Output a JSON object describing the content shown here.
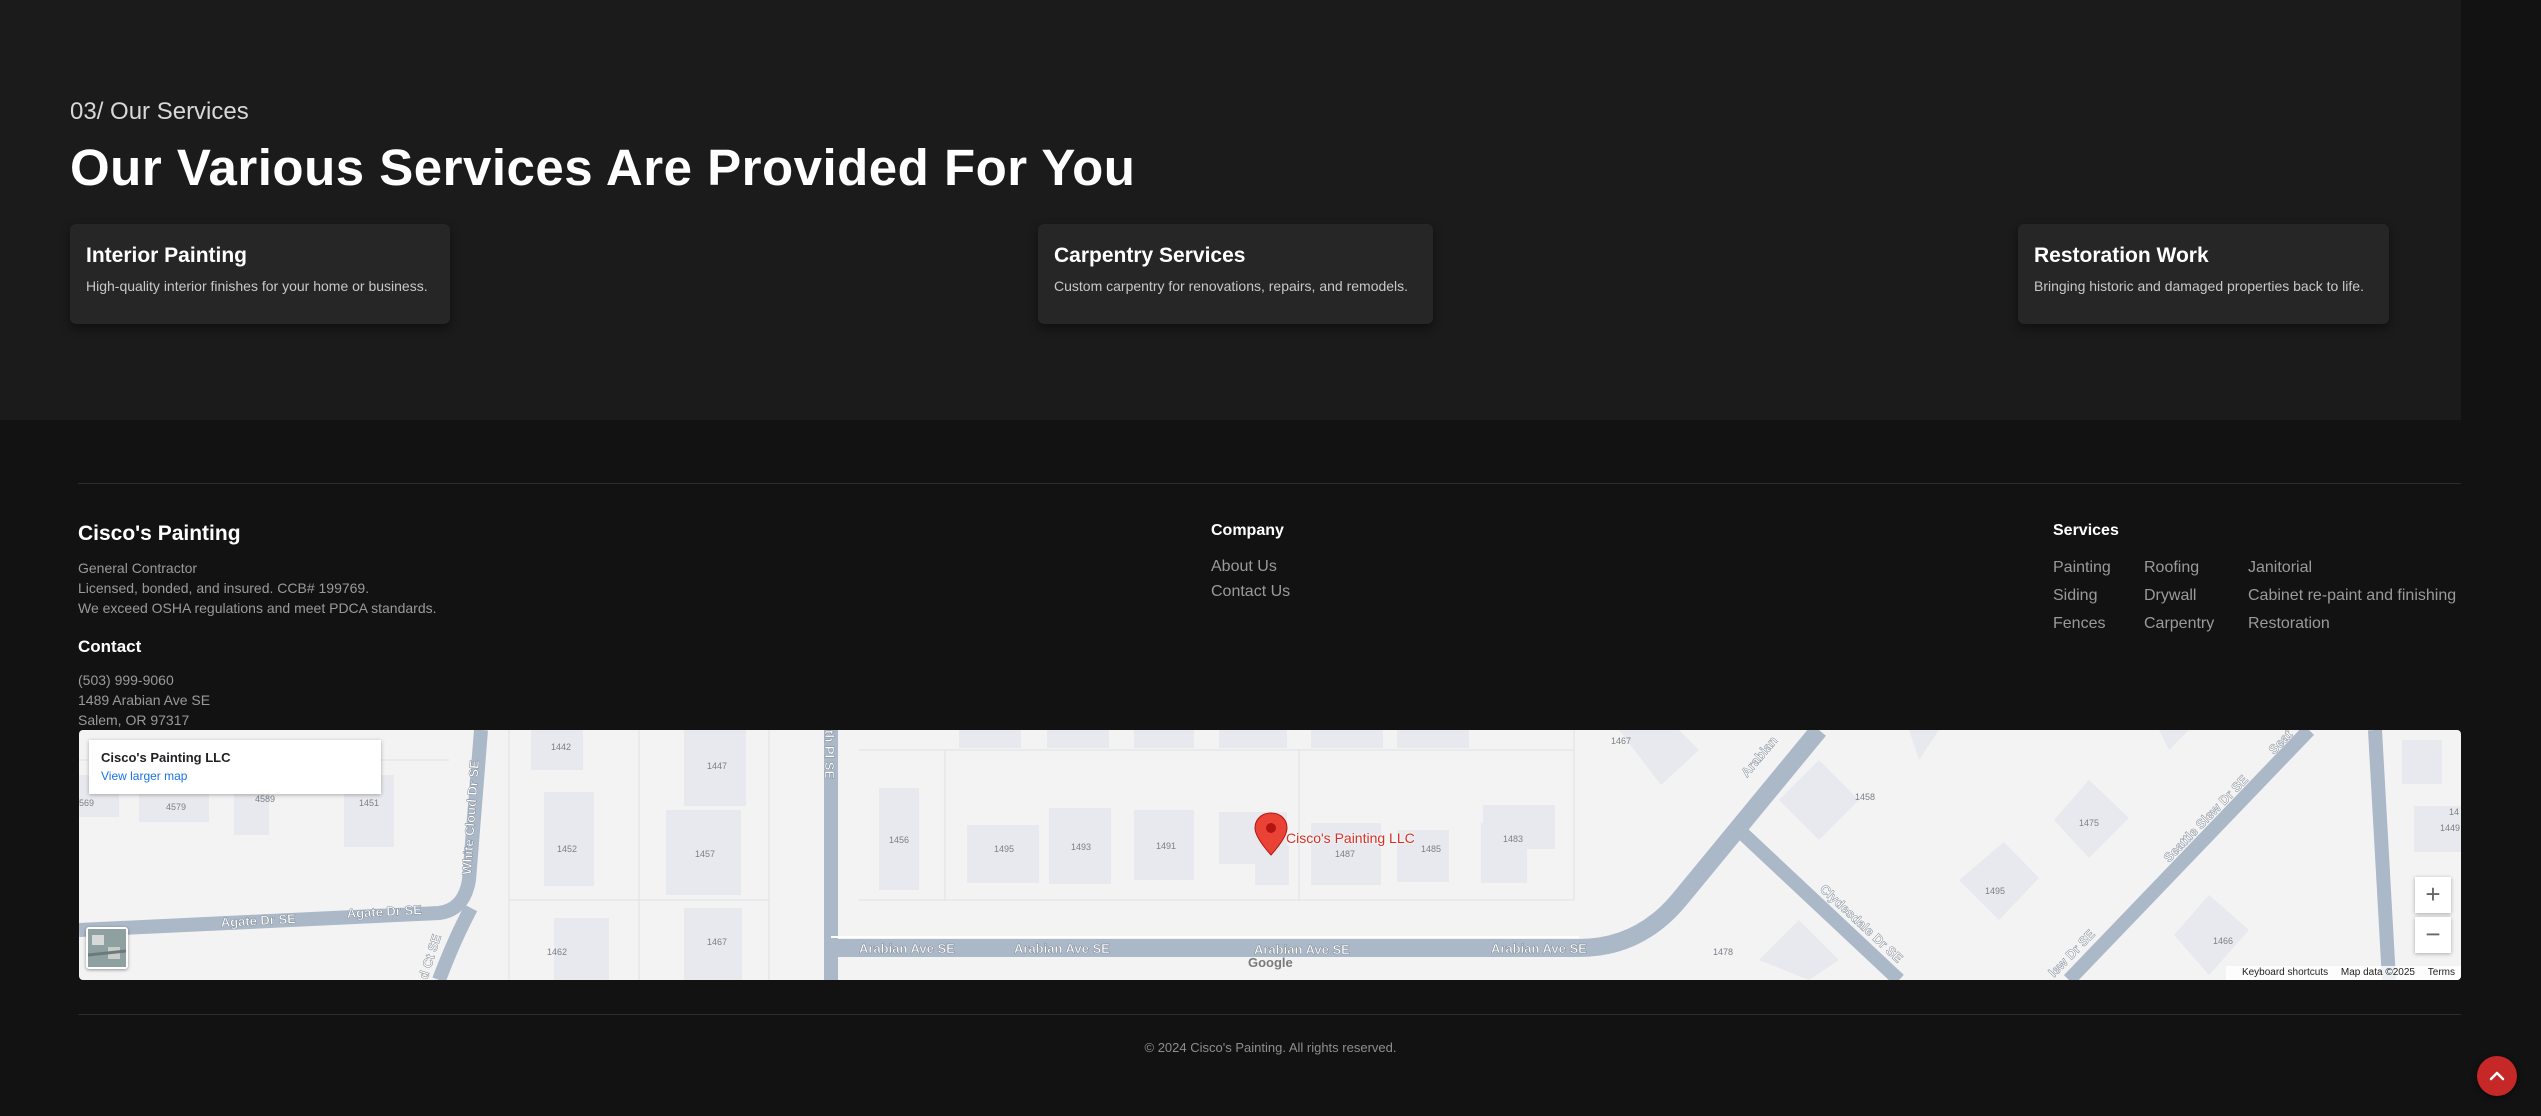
{
  "services": {
    "eyebrow": "03/ Our Services",
    "heading": "Our Various Services Are Provided For You",
    "cards": [
      {
        "title": "Interior Painting",
        "description": "High-quality interior finishes for your home or business."
      },
      {
        "title": "Carpentry Services",
        "description": "Custom carpentry for renovations, repairs, and remodels."
      },
      {
        "title": "Restoration Work",
        "description": "Bringing historic and damaged properties back to life."
      }
    ]
  },
  "footer": {
    "brand": {
      "title": "Cisco's Painting",
      "lines": [
        "General Contractor",
        "Licensed, bonded, and insured. CCB# 199769.",
        "We exceed OSHA regulations and meet PDCA standards."
      ]
    },
    "contact": {
      "title": "Contact",
      "phone": "(503) 999-9060",
      "address_line1": "1489 Arabian Ave SE",
      "address_line2": "Salem, OR 97317"
    },
    "company": {
      "title": "Company",
      "links": [
        "About Us",
        "Contact Us"
      ]
    },
    "service_links": {
      "title": "Services",
      "columns": [
        [
          "Painting",
          "Siding",
          "Fences"
        ],
        [
          "Roofing",
          "Drywall",
          "Carpentry"
        ],
        [
          "Janitorial",
          "Cabinet re-paint and finishing",
          "Restoration"
        ]
      ]
    },
    "copyright": "© 2024 Cisco's Painting. All rights reserved."
  },
  "map": {
    "place_name": "Cisco's Painting LLC",
    "larger_map_link": "View larger map",
    "marker_label": "Cisco's Painting LLC",
    "zoom_in": "+",
    "zoom_out": "−",
    "google_logo": "Google",
    "attribution": {
      "shortcuts": "Keyboard shortcuts",
      "data": "Map data ©2025",
      "terms": "Terms"
    },
    "street_labels": [
      "Arabian Ave SE",
      "Arabian Ave SE",
      "Arabian Ave SE",
      "Arabian Ave SE",
      "Agate Dr SE",
      "Agate Dr SE",
      "White Cloud Dr SE",
      "Clydesdale Dr SE",
      "Seattle Slew Dr SE",
      "Arabian",
      "th Pl SE",
      "d Ct SE",
      "Seat",
      "lew Dr SE"
    ],
    "house_numbers": [
      "1442",
      "1447",
      "4589",
      "4579",
      "1451",
      "569",
      "1452",
      "1457",
      "1462",
      "1467",
      "1456",
      "1495",
      "1493",
      "1491",
      "1487",
      "1485",
      "1483",
      "1467",
      "1458",
      "1475",
      "1495",
      "1478",
      "1466",
      "14",
      "1449"
    ]
  },
  "colors": {
    "accent": "#c62828",
    "marker": "#d93025",
    "link": "#1a73e8"
  },
  "icons": {
    "back_to_top": "chevron-up-icon",
    "map_layers": "satellite-thumbnail-icon"
  }
}
